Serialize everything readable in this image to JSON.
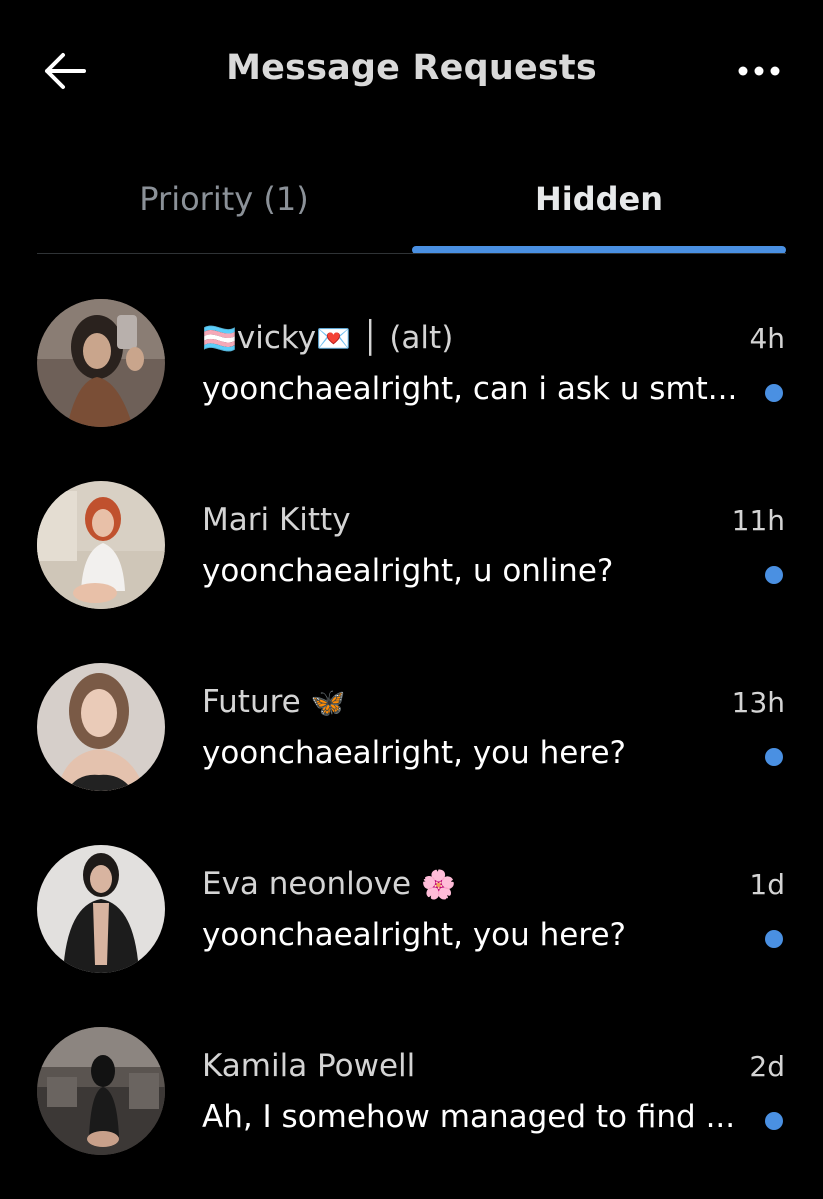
{
  "header": {
    "title": "Message Requests",
    "back_icon": "arrow-left-icon",
    "more_icon": "more-horizontal-icon"
  },
  "tabs": [
    {
      "label": "Priority (1)",
      "selected": false
    },
    {
      "label": "Hidden",
      "selected": true
    }
  ],
  "colors": {
    "accent": "#4a90e2",
    "background": "#000000",
    "muted_text": "#8b9198"
  },
  "conversations": [
    {
      "name": "vicky",
      "name_prefix_emoji": "🏳️‍⚧️",
      "name_suffix_emoji": "💌",
      "name_extra": "│ (alt)",
      "time": "4h",
      "preview": "yoonchaealright, can i ask u smt...",
      "unread": true
    },
    {
      "name": "Mari Kitty",
      "name_prefix_emoji": "",
      "name_suffix_emoji": "",
      "name_extra": "",
      "time": "11h",
      "preview": "yoonchaealright, u online?",
      "unread": true
    },
    {
      "name": "Future",
      "name_prefix_emoji": "",
      "name_suffix_emoji": "🦋",
      "name_extra": "",
      "time": "13h",
      "preview": "yoonchaealright, you here?",
      "unread": true
    },
    {
      "name": "Eva neonlove",
      "name_prefix_emoji": "",
      "name_suffix_emoji": "🌸",
      "name_extra": "",
      "time": "1d",
      "preview": "yoonchaealright, you here?",
      "unread": true
    },
    {
      "name": "Kamila Powell",
      "name_prefix_emoji": "",
      "name_suffix_emoji": "",
      "name_extra": "",
      "time": "2d",
      "preview": "Ah, I somehow managed to find ...",
      "unread": true
    }
  ]
}
